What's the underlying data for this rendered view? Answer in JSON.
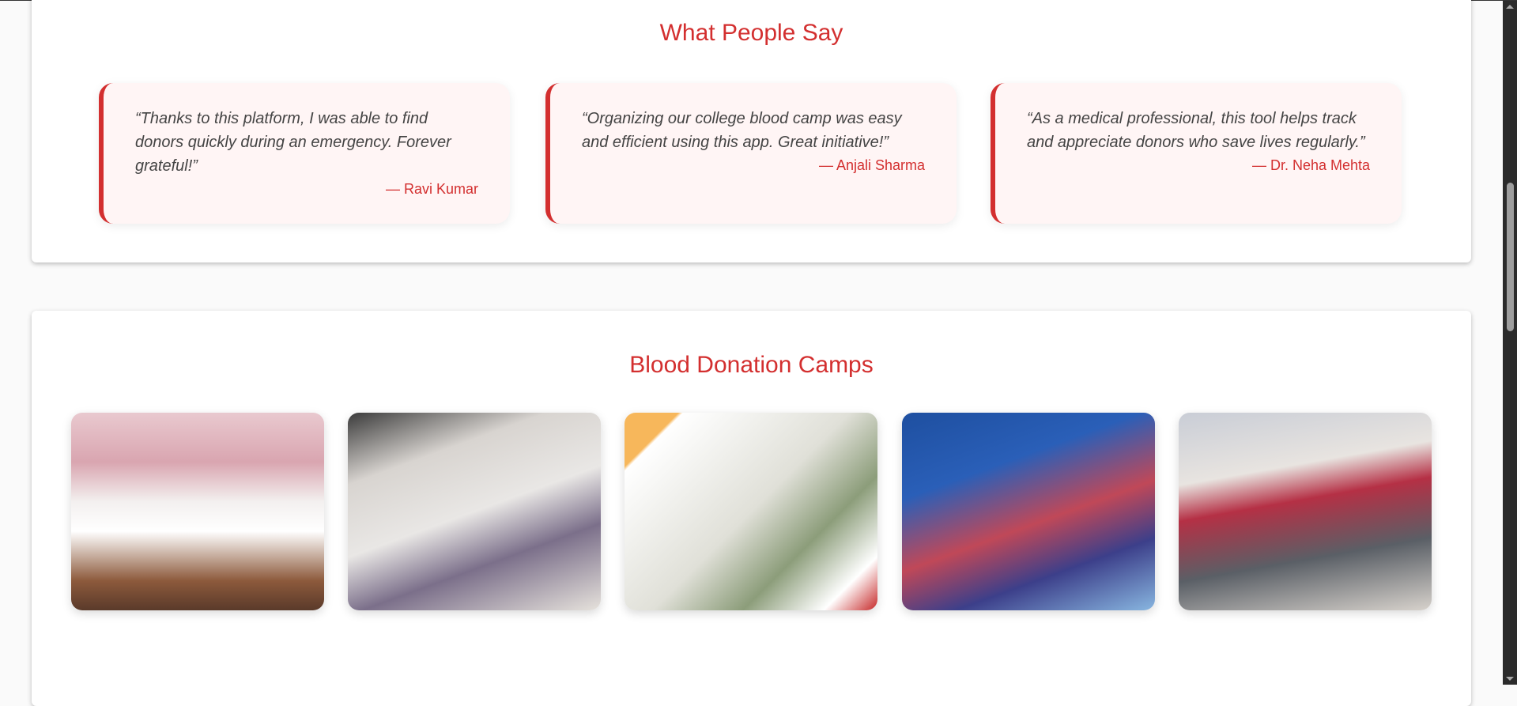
{
  "testimonials": {
    "title": "What People Say",
    "items": [
      {
        "quote": "“Thanks to this platform, I was able to find donors quickly during an emergency. Forever grateful!”",
        "author": "— Ravi Kumar"
      },
      {
        "quote": "“Organizing our college blood camp was easy and efficient using this app. Great initiative!”",
        "author": "— Anjali Sharma"
      },
      {
        "quote": "“As a medical professional, this tool helps track and appreciate donors who save lives regularly.”",
        "author": "— Dr. Neha Mehta"
      }
    ]
  },
  "camps": {
    "title": "Blood Donation Camps",
    "image_count": 5
  },
  "colors": {
    "accent": "#d32f2f",
    "card_bg": "#fff5f5",
    "page_bg": "#fafafa"
  }
}
